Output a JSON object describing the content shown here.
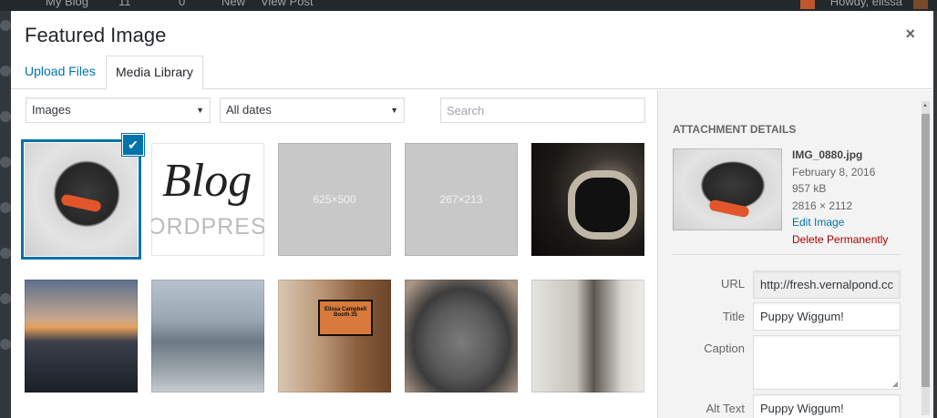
{
  "adminbar": {
    "site_name": "My Blog",
    "updates": "11",
    "comments": "0",
    "new": "New",
    "view_post": "View Post",
    "howdy": "Howdy, elissa"
  },
  "modal": {
    "title": "Featured Image",
    "close_icon": "×"
  },
  "tabs": {
    "upload": "Upload Files",
    "library": "Media Library"
  },
  "toolbar": {
    "type_selected": "Images",
    "date_selected": "All dates",
    "search_placeholder": "Search",
    "arrow": "▼"
  },
  "grid": {
    "check_icon": "✔",
    "items": [
      {
        "kind": "image",
        "subject": "black poodle with orange collar",
        "selected": true
      },
      {
        "kind": "image",
        "subject": "Blog wordpress logo",
        "text_big": "Blog",
        "text_small": "ORDPRESS"
      },
      {
        "kind": "placeholder",
        "label": "625×500"
      },
      {
        "kind": "placeholder",
        "label": "267×213"
      },
      {
        "kind": "image",
        "subject": "vintage camera"
      },
      {
        "kind": "image",
        "subject": "city skyline at sunset"
      },
      {
        "kind": "image",
        "subject": "city buildings by river"
      },
      {
        "kind": "image",
        "subject": "booth sign on wall"
      },
      {
        "kind": "image",
        "subject": "grey poodle close-up"
      },
      {
        "kind": "image",
        "subject": "woman sitting on floor"
      }
    ]
  },
  "sidebar": {
    "title": "ATTACHMENT DETAILS",
    "filename": "IMG_0880.jpg",
    "date": "February 8, 2016",
    "size": "957 kB",
    "dimensions": "2816 × 2112",
    "edit_link": "Edit Image",
    "delete_link": "Delete Permanently",
    "fields": {
      "url_label": "URL",
      "url_value": "http://fresh.vernalpond.cc",
      "title_label": "Title",
      "title_value": "Puppy Wiggum!",
      "caption_label": "Caption",
      "caption_value": "",
      "alt_label": "Alt Text",
      "alt_value": "Puppy Wiggum!"
    }
  },
  "colors": {
    "accent": "#0073aa",
    "danger": "#a00000",
    "sidebar_bg": "#f3f3f3"
  }
}
